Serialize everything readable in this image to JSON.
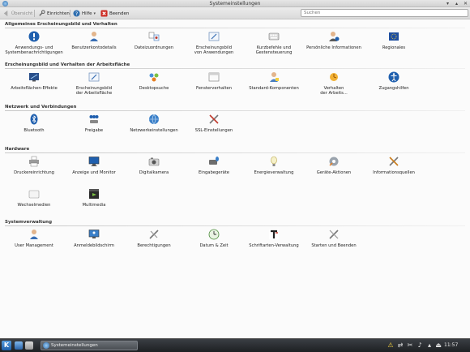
{
  "window": {
    "title": "Systemeinstellungen"
  },
  "toolbar": {
    "overview_label": "Übersicht",
    "configure_label": "Einrichten",
    "help_label": "Hilfe",
    "quit_label": "Beenden",
    "search_placeholder": "Suchen"
  },
  "sections": [
    {
      "title": "Allgemeines Erscheinungsbild und Verhalten",
      "items": [
        {
          "label": "Anwendungs- und\nSystembenachrichtigungen",
          "icon": "info-icon"
        },
        {
          "label": "Benutzerkontodetails",
          "icon": "user-account-icon"
        },
        {
          "label": "Dateizuordnungen",
          "icon": "file-associations-icon"
        },
        {
          "label": "Erscheinungsbild\nvon Anwendungen",
          "icon": "app-appearance-icon"
        },
        {
          "label": "Kurzbefehle und\nGestensteuerung",
          "icon": "keyboard-shortcuts-icon"
        },
        {
          "label": "Persönliche Informationen",
          "icon": "personal-info-icon"
        },
        {
          "label": "Regionales",
          "icon": "regional-icon"
        }
      ]
    },
    {
      "title": "Erscheinungsbild und Verhalten der Arbeitsfläche",
      "items": [
        {
          "label": "Arbeitsflächen-Effekte",
          "icon": "desktop-effects-icon"
        },
        {
          "label": "Erscheinungsbild\nder Arbeitsfläche",
          "icon": "workspace-appearance-icon"
        },
        {
          "label": "Desktopsuche",
          "icon": "desktop-search-icon"
        },
        {
          "label": "Fensterverhalten",
          "icon": "window-behavior-icon"
        },
        {
          "label": "Standard-Komponenten",
          "icon": "default-components-icon"
        },
        {
          "label": "Verhalten\nder Arbeits...",
          "icon": "workspace-behavior-icon"
        },
        {
          "label": "Zugangshilfen",
          "icon": "accessibility-icon"
        }
      ]
    },
    {
      "title": "Netzwerk und Verbindungen",
      "items": [
        {
          "label": "Bluetooth",
          "icon": "bluetooth-icon"
        },
        {
          "label": "Freigabe",
          "icon": "sharing-icon"
        },
        {
          "label": "Netzwerkeinstellungen",
          "icon": "network-settings-icon"
        },
        {
          "label": "SSL-Einstellungen",
          "icon": "ssl-tools-icon"
        }
      ]
    },
    {
      "title": "Hardware",
      "items": [
        {
          "label": "Druckereinrichtung",
          "icon": "printer-icon"
        },
        {
          "label": "Anzeige und Monitor",
          "icon": "monitor-icon"
        },
        {
          "label": "Digitalkamera",
          "icon": "camera-icon"
        },
        {
          "label": "Eingabegeräte",
          "icon": "input-devices-icon"
        },
        {
          "label": "Energieverwaltung",
          "icon": "power-management-icon"
        },
        {
          "label": "Geräte-Aktionen",
          "icon": "device-actions-icon"
        },
        {
          "label": "Informationsquellen",
          "icon": "info-sources-icon"
        },
        {
          "label": "Wechselmedien",
          "icon": "removable-media-icon"
        },
        {
          "label": "Multimedia",
          "icon": "multimedia-icon"
        }
      ]
    },
    {
      "title": "Systemverwaltung",
      "items": [
        {
          "label": "User Management",
          "icon": "user-management-icon"
        },
        {
          "label": "Anmeldebildschirm",
          "icon": "login-screen-icon"
        },
        {
          "label": "Berechtigungen",
          "icon": "permissions-icon"
        },
        {
          "label": "Datum & Zeit",
          "icon": "date-time-icon"
        },
        {
          "label": "Schriftarten-Verwaltung",
          "icon": "font-management-icon"
        },
        {
          "label": "Starten und Beenden",
          "icon": "startup-shutdown-icon"
        }
      ]
    }
  ],
  "taskbar": {
    "task_label": "Systemeinstellungen",
    "clock": "11:57"
  },
  "colors": {
    "accent": "#2f6fb0",
    "panel": "#2a2d31"
  }
}
